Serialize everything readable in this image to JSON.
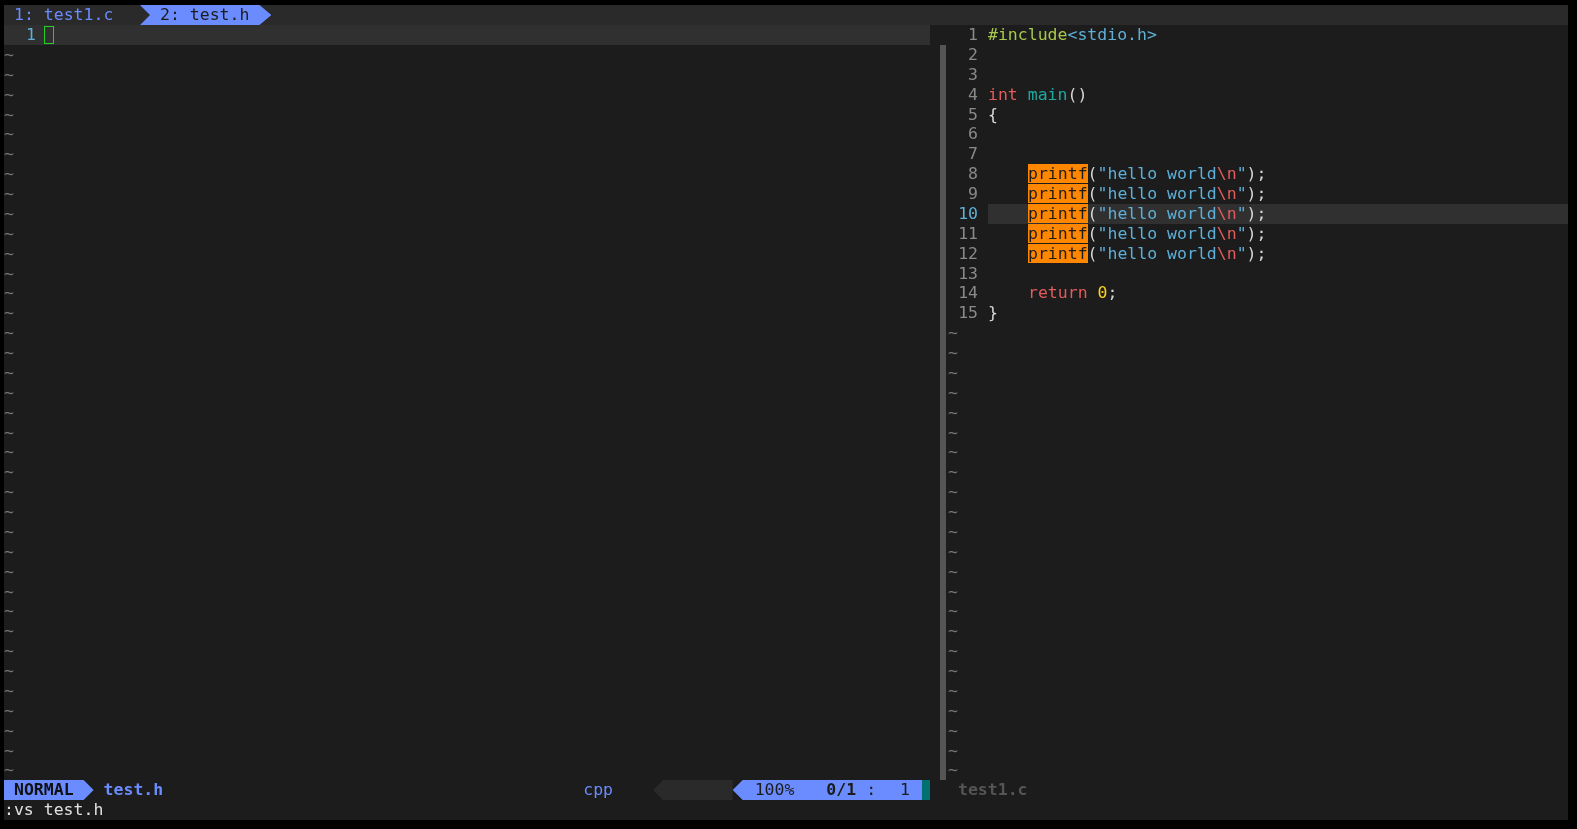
{
  "tabs": [
    {
      "label": "1: test1.c",
      "selected": false
    },
    {
      "label": "2: test.h",
      "selected": true
    }
  ],
  "left_pane": {
    "lines": [
      {
        "number": "1",
        "current": true,
        "cursor": true
      }
    ],
    "filler_lines": [
      "~",
      "~",
      "~",
      "~",
      "~",
      "~",
      "~",
      "~",
      "~",
      "~",
      "~",
      "~",
      "~",
      "~",
      "~",
      "~",
      "~",
      "~",
      "~",
      "~",
      "~",
      "~",
      "~",
      "~",
      "~",
      "~",
      "~",
      "~",
      "~",
      "~",
      "~",
      "~",
      "~",
      "~",
      "~",
      "~",
      "~"
    ]
  },
  "right_pane": {
    "lines": [
      {
        "number": "1",
        "current": false,
        "tokens": [
          {
            "kind": "preproc",
            "text": "#include"
          },
          {
            "kind": "header",
            "text": "<stdio.h>"
          }
        ]
      },
      {
        "number": "2",
        "current": false
      },
      {
        "number": "3",
        "current": false
      },
      {
        "number": "4",
        "current": false,
        "tokens": [
          {
            "kind": "keyword",
            "text": "int"
          },
          {
            "kind": "function",
            "text": " main"
          },
          {
            "kind": "plain",
            "text": "()"
          }
        ]
      },
      {
        "number": "5",
        "current": false,
        "tokens": [
          {
            "kind": "plain",
            "text": "{"
          }
        ]
      },
      {
        "number": "6",
        "current": false
      },
      {
        "number": "7",
        "current": false
      },
      {
        "number": "8",
        "current": false,
        "indented": true,
        "tokens": [
          {
            "kind": "match",
            "text": "printf"
          },
          {
            "kind": "plain",
            "text": "("
          },
          {
            "kind": "string",
            "text": "\"hello world"
          },
          {
            "kind": "escape",
            "text": "\\n"
          },
          {
            "kind": "string",
            "text": "\""
          },
          {
            "kind": "plain",
            "text": ");"
          }
        ]
      },
      {
        "number": "9",
        "current": false,
        "indented": true,
        "tokens": [
          {
            "kind": "match",
            "text": "printf"
          },
          {
            "kind": "plain",
            "text": "("
          },
          {
            "kind": "string",
            "text": "\"hello world"
          },
          {
            "kind": "escape",
            "text": "\\n"
          },
          {
            "kind": "string",
            "text": "\""
          },
          {
            "kind": "plain",
            "text": ");"
          }
        ]
      },
      {
        "number": "10",
        "current": true,
        "indented": true,
        "tokens": [
          {
            "kind": "match",
            "text": "printf"
          },
          {
            "kind": "plain",
            "text": "("
          },
          {
            "kind": "string",
            "text": "\"hello world"
          },
          {
            "kind": "escape",
            "text": "\\n"
          },
          {
            "kind": "string",
            "text": "\""
          },
          {
            "kind": "plain",
            "text": ");"
          }
        ]
      },
      {
        "number": "11",
        "current": false,
        "indented": true,
        "tokens": [
          {
            "kind": "match",
            "text": "printf"
          },
          {
            "kind": "plain",
            "text": "("
          },
          {
            "kind": "string",
            "text": "\"hello world"
          },
          {
            "kind": "escape",
            "text": "\\n"
          },
          {
            "kind": "string",
            "text": "\""
          },
          {
            "kind": "plain",
            "text": ");"
          }
        ]
      },
      {
        "number": "12",
        "current": false,
        "indented": true,
        "tokens": [
          {
            "kind": "match",
            "text": "printf"
          },
          {
            "kind": "plain",
            "text": "("
          },
          {
            "kind": "string",
            "text": "\"hello world"
          },
          {
            "kind": "escape",
            "text": "\\n"
          },
          {
            "kind": "string",
            "text": "\""
          },
          {
            "kind": "plain",
            "text": ");"
          }
        ]
      },
      {
        "number": "13",
        "current": false
      },
      {
        "number": "14",
        "current": false,
        "indented": true,
        "tokens": [
          {
            "kind": "keyword",
            "text": "return"
          },
          {
            "kind": "number",
            "text": " 0"
          },
          {
            "kind": "plain",
            "text": ";"
          }
        ]
      },
      {
        "number": "15",
        "current": false,
        "tokens": [
          {
            "kind": "plain",
            "text": "}"
          }
        ]
      }
    ],
    "filler_lines": [
      "~",
      "~",
      "~",
      "~",
      "~",
      "~",
      "~",
      "~",
      "~",
      "~",
      "~",
      "~",
      "~",
      "~",
      "~",
      "~",
      "~",
      "~",
      "~",
      "~",
      "~",
      "~",
      "~"
    ]
  },
  "status_bar": {
    "mode": "NORMAL",
    "file": "test.h",
    "filetype": "cpp",
    "percent": "100%",
    "match_count": "0/1",
    "separator": ":",
    "column": "1",
    "inactive_file": "test1.c"
  },
  "command_line": ":vs test.h"
}
